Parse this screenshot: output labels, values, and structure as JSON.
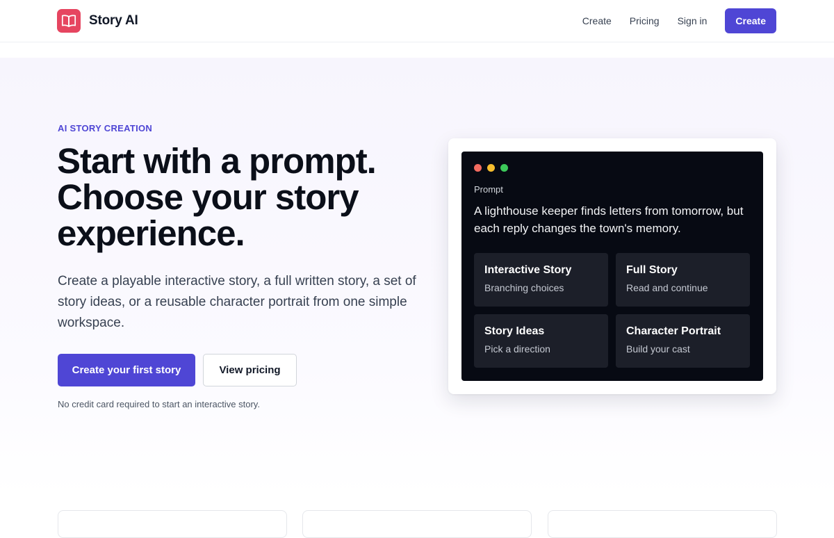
{
  "brand": {
    "name": "Story AI",
    "logo_icon": "open-book-icon",
    "logo_color": "#e64560"
  },
  "nav": {
    "links": [
      "Create",
      "Pricing",
      "Sign in"
    ],
    "cta_label": "Create",
    "accent": "#4f46d5"
  },
  "hero": {
    "eyebrow": "AI STORY CREATION",
    "headline_lines": [
      "Start with a prompt.",
      "Choose your story",
      "experience."
    ],
    "subhead": "Create a playable interactive story, a full written story, a set of story ideas, or a reusable character portrait from one simple workspace.",
    "primary_button": "Create your first story",
    "secondary_button": "View pricing",
    "fineprint": "No credit card required to start an interactive story."
  },
  "preview": {
    "window_dots": [
      "#f26b60",
      "#f5bd2e",
      "#3cc95a"
    ],
    "prompt_label": "Prompt",
    "prompt_text": "A lighthouse keeper finds letters from tomorrow, but each reply changes the town's memory.",
    "modes": [
      {
        "title": "Interactive Story",
        "subtitle": "Branching choices"
      },
      {
        "title": "Full Story",
        "subtitle": "Read and continue"
      },
      {
        "title": "Story Ideas",
        "subtitle": "Pick a direction"
      },
      {
        "title": "Character Portrait",
        "subtitle": "Build your cast"
      }
    ]
  }
}
